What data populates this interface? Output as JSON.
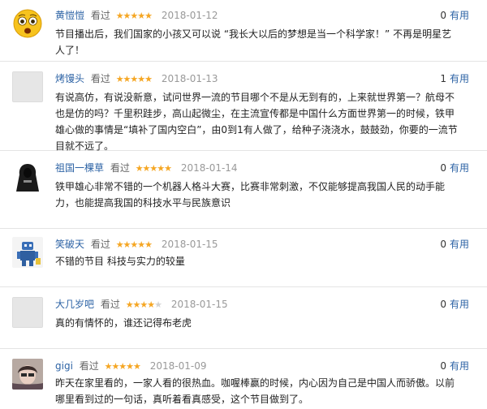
{
  "reviews": [
    {
      "user": "黄愷愷",
      "watched": "看过",
      "stars": "★★★★★",
      "stars_off": "",
      "date": "2018-01-12",
      "useful_count": "0",
      "useful_label": "有用",
      "text": "节目播出后，我们国家的小孩又可以说 “我长大以后的梦想是当一个科学家！” 不再是明星艺人了！"
    },
    {
      "user": "烤馒头",
      "watched": "看过",
      "stars": "★★★★★",
      "stars_off": "",
      "date": "2018-01-13",
      "useful_count": "1",
      "useful_label": "有用",
      "text": "有说高仿，有说没新意，试问世界一流的节目哪个不是从无到有的，上来就世界第一？航母不也是仿的吗？千里积跬步，高山起微尘，在主流宣传都是中国什么方面世界第一的时候，铁甲雄心做的事情是“填补了国内空白”，由0到1有人做了，给种子浇浇水，鼓鼓劲，你要的一流节目就不远了。"
    },
    {
      "user": "祖国一棵草",
      "watched": "看过",
      "stars": "★★★★★",
      "stars_off": "",
      "date": "2018-01-14",
      "useful_count": "0",
      "useful_label": "有用",
      "text": "铁甲雄心非常不错的一个机器人格斗大赛，比赛非常刺激，不仅能够提高我国人民的动手能力，也能提高我国的科技水平与民族意识"
    },
    {
      "user": "笑破天",
      "watched": "看过",
      "stars": "★★★★★",
      "stars_off": "",
      "date": "2018-01-15",
      "useful_count": "0",
      "useful_label": "有用",
      "text": "不错的节目 科技与实力的较量"
    },
    {
      "user": "大几岁吧",
      "watched": "看过",
      "stars": "★★★★",
      "stars_off": "★",
      "date": "2018-01-15",
      "useful_count": "0",
      "useful_label": "有用",
      "text": "真的有情怀的，谁还记得布老虎"
    },
    {
      "user": "gigi",
      "watched": "看过",
      "stars": "★★★★★",
      "stars_off": "",
      "date": "2018-01-09",
      "useful_count": "0",
      "useful_label": "有用",
      "text": "昨天在家里看的，一家人看的很热血。咖喔棒赢的时候，内心因为自己是中国人而骄傲。以前哪里看到过的一句话，真听着看真感受，这个节目做到了。"
    }
  ],
  "colors": {
    "user_link": "#2d63a5",
    "star": "#f5a623",
    "date": "#999999",
    "divider": "#e4e4e4"
  },
  "icons": [
    "emoji-avatar-icon",
    "default-avatar-icon",
    "hooded-figure-avatar-icon",
    "robot-avatar-icon",
    "default-avatar-icon",
    "photo-avatar-icon"
  ]
}
